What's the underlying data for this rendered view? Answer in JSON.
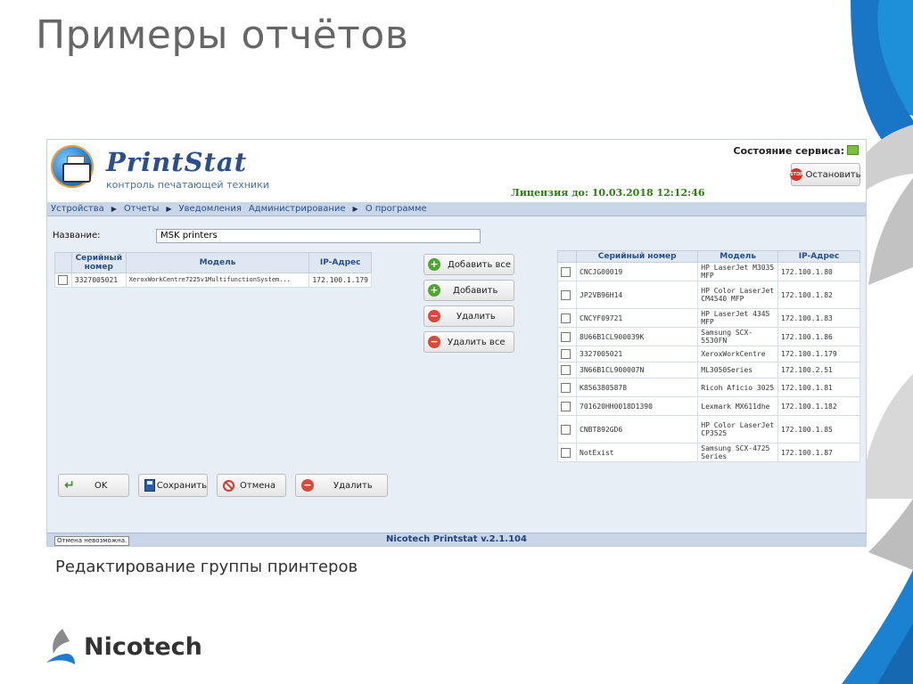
{
  "slide": {
    "title": "Примеры отчётов",
    "caption": "Редактирование группы принтеров",
    "company": "Nicotech"
  },
  "app": {
    "brand": "PrintStat",
    "tagline": "контроль печатающей техники",
    "service_status_label": "Состояние сервиса:",
    "stop_button": "Остановить",
    "license": "Лицензия до: 10.03.2018 12:12:46",
    "menu": [
      "Устройства",
      "Отчеты",
      "Уведомления",
      "Администрирование",
      "О программе"
    ],
    "name_label": "Название:",
    "name_value": "MSK printers",
    "left_table": {
      "headers": [
        "Серийный номер",
        "Модель",
        "IP-Адрес"
      ],
      "rows": [
        {
          "serial": "3327005021",
          "model": "XeroxWorkCentre7225v1MultifunctionSystem...",
          "ip": "172.100.1.179"
        }
      ]
    },
    "actions": {
      "add_all": "Добавить все",
      "add": "Добавить",
      "remove": "Удалить",
      "remove_all": "Удалить все"
    },
    "right_table": {
      "headers": [
        "Серийный номер",
        "Модель",
        "IP-Адрес"
      ],
      "rows": [
        {
          "serial": "CNCJG00019",
          "model": "HP LaserJet M3035 MFP",
          "ip": "172.100.1.80"
        },
        {
          "serial": "JP2VB96H14",
          "model": "HP Color LaserJet CM4540 MFP",
          "ip": "172.100.1.82"
        },
        {
          "serial": "CNCYF09721",
          "model": "HP LaserJet 4345 MFP",
          "ip": "172.100.1.83"
        },
        {
          "serial": "8U66B1CL900039K",
          "model": "Samsung SCX-5530FN",
          "ip": "172.100.1.86"
        },
        {
          "serial": "3327005021",
          "model": "XeroxWorkCentre",
          "ip": "172.100.1.179"
        },
        {
          "serial": "3N66B1CL900007N",
          "model": "ML3050Series",
          "ip": "172.100.2.51"
        },
        {
          "serial": "K8563805878",
          "model": "Ricoh Aficio 3025",
          "ip": "172.100.1.81"
        },
        {
          "serial": "701620HH0018D1390",
          "model": "Lexmark MX611dhe",
          "ip": "172.100.1.182"
        },
        {
          "serial": "CNBT892GD6",
          "model": "HP Color LaserJet CP3525",
          "ip": "172.100.1.85"
        },
        {
          "serial": "NotExist",
          "model": "Samsung SCX-4725 Series",
          "ip": "172.100.1.87"
        }
      ]
    },
    "bottom_buttons": {
      "ok": "OK",
      "save": "Сохранить",
      "cancel": "Отмена",
      "delete": "Удалить"
    },
    "footer": "Nicotech Printstat v.2.1.104",
    "status_tooltip": "Отмена невозможна."
  },
  "colors": {
    "title_gray": "#666666",
    "accent_blue": "#1e7bd0",
    "license_green": "#2e7d0f",
    "menu_bg": "#c8d6e8"
  }
}
